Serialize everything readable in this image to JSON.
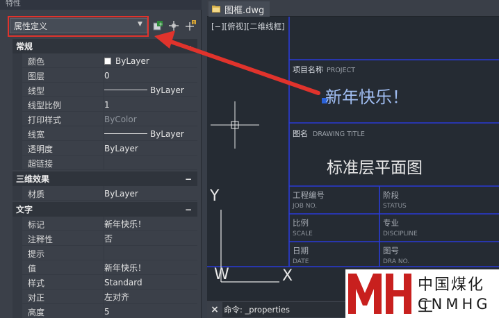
{
  "palette": {
    "title": "特性",
    "selected_object": "属性定义",
    "sections": [
      {
        "title": "常规",
        "rows": [
          {
            "key": "颜色",
            "value": "ByLayer",
            "kind": "color",
            "swatch": "#ffffff"
          },
          {
            "key": "图层",
            "value": "0",
            "kind": "text"
          },
          {
            "key": "线型",
            "value": "ByLayer",
            "kind": "line"
          },
          {
            "key": "线型比例",
            "value": "1",
            "kind": "text"
          },
          {
            "key": "打印样式",
            "value": "ByColor",
            "kind": "dim"
          },
          {
            "key": "线宽",
            "value": "ByLayer",
            "kind": "line"
          },
          {
            "key": "透明度",
            "value": "ByLayer",
            "kind": "text"
          },
          {
            "key": "超链接",
            "value": "",
            "kind": "text"
          }
        ]
      },
      {
        "title": "三维效果",
        "rows": [
          {
            "key": "材质",
            "value": "ByLayer",
            "kind": "text"
          }
        ]
      },
      {
        "title": "文字",
        "rows": [
          {
            "key": "标记",
            "value": "新年快乐！",
            "kind": "text"
          },
          {
            "key": "注释性",
            "value": "否",
            "kind": "text"
          },
          {
            "key": "提示",
            "value": "",
            "kind": "text"
          },
          {
            "key": "值",
            "value": "新年快乐！",
            "kind": "text"
          },
          {
            "key": "样式",
            "value": "Standard",
            "kind": "text"
          },
          {
            "key": "对正",
            "value": "左对齐",
            "kind": "text"
          },
          {
            "key": "高度",
            "value": "5",
            "kind": "text"
          }
        ]
      }
    ],
    "toolbar_icons": [
      "quick-select-icon",
      "select-objects-icon",
      "toggle-pickadd-icon"
    ],
    "collapse_symbol": "−"
  },
  "drawing": {
    "tab_title": "图框.dwg",
    "viewport_label": "[−][俯视][二维线框]",
    "title_block": {
      "project_label_cn": "项目名称",
      "project_label_en": "PROJECT",
      "project_value": "新年快乐！",
      "drawing_title_cn": "图名",
      "drawing_title_en": "DRAWING TITLE",
      "drawing_title_value": "标准层平面图",
      "cells": [
        {
          "cn": "工程编号",
          "en": "JOB NO."
        },
        {
          "cn": "阶段",
          "en": "STATUS"
        },
        {
          "cn": "比例",
          "en": "SCALE"
        },
        {
          "cn": "专业",
          "en": "DISCIPLINE"
        },
        {
          "cn": "日期",
          "en": "DATE"
        },
        {
          "cn": "图号",
          "en": "DRA NO."
        }
      ]
    },
    "ucs": {
      "y_label": "Y",
      "x_label": "X",
      "w_label": "W"
    },
    "command_close": "×",
    "command_text": "命令: _properties"
  },
  "colors": {
    "highlight": "#e0332c",
    "frame_line": "#2a3bd8",
    "text_light": "#d8dce2"
  },
  "logo": {
    "mark": "MH",
    "text_cn": "中国煤化工",
    "text_en": "CNMHG"
  }
}
